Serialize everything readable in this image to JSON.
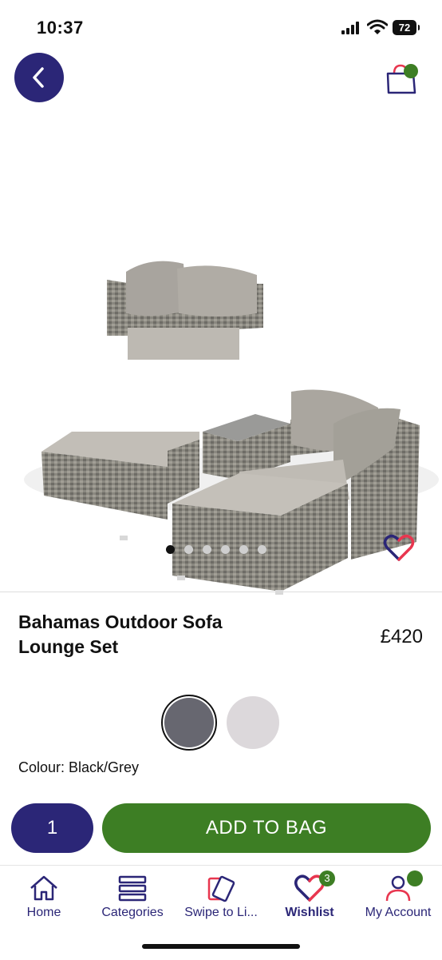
{
  "status_bar": {
    "time": "10:37",
    "battery": "72"
  },
  "header": {
    "back_icon": "chevron-left-icon",
    "bag_icon": "shopping-bag-icon",
    "bag_has_items": true
  },
  "gallery": {
    "image_count": 6,
    "active_index": 0,
    "wishlist_icon": "heart-icon"
  },
  "product": {
    "title": "Bahamas Outdoor Sofa Lounge Set",
    "price": "£420",
    "swatches": [
      {
        "name": "Black/Grey",
        "color": "#676770",
        "selected": true
      },
      {
        "name": "Light",
        "color": "#dcd8db",
        "selected": false
      }
    ],
    "colour_label": "Colour: Black/Grey"
  },
  "actions": {
    "quantity": "1",
    "add_label": "ADD TO BAG"
  },
  "tabs": [
    {
      "label": "Home",
      "icon": "home-icon"
    },
    {
      "label": "Categories",
      "icon": "list-icon"
    },
    {
      "label": "Swipe to Li...",
      "icon": "cards-icon"
    },
    {
      "label": "Wishlist",
      "icon": "heart-icon",
      "badge": "3",
      "active": true
    },
    {
      "label": "My Account",
      "icon": "user-icon"
    }
  ],
  "colors": {
    "brand_navy": "#2b2677",
    "brand_green": "#3d7e24",
    "accent_red": "#e8364f"
  }
}
